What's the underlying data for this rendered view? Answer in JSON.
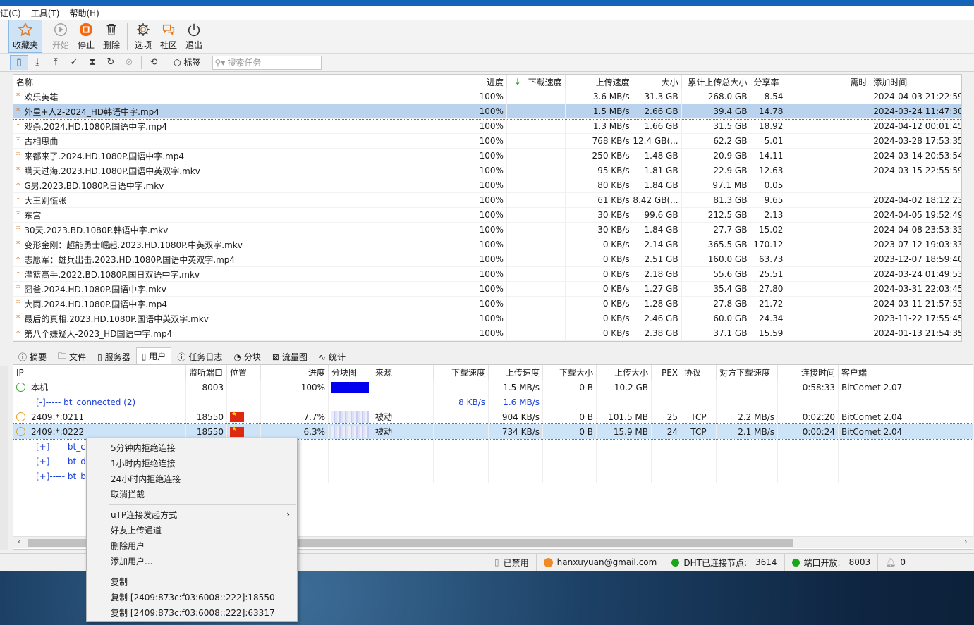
{
  "menu": [
    "证(C)",
    "工具(T)",
    "帮助(H)"
  ],
  "toolbar": {
    "favorites": "收藏夹",
    "start": "开始",
    "stop": "停止",
    "delete": "删除",
    "options": "选项",
    "community": "社区",
    "exit": "退出"
  },
  "filterbar": {
    "tag_label": "标签",
    "search_placeholder": "搜索任务"
  },
  "task_headers": {
    "name": "名称",
    "progress": "进度",
    "down_speed": "下载速度",
    "up_speed": "上传速度",
    "size": "大小",
    "total_up": "累计上传总大小",
    "ratio": "分享率",
    "need": "需时",
    "added": "添加时间"
  },
  "tasks": [
    {
      "name": "欢乐英雄",
      "progress": "100%",
      "up": "3.6 MB/s",
      "size": "31.3 GB",
      "total": "268.0 GB",
      "ratio": "8.54",
      "added": "2024-04-03 21:22:59"
    },
    {
      "name": "外星+人2-2024_HD韩语中字.mp4",
      "progress": "100%",
      "up": "1.5 MB/s",
      "size": "2.66 GB",
      "total": "39.4 GB",
      "ratio": "14.78",
      "added": "2024-03-24 11:47:30"
    },
    {
      "name": "戏杀.2024.HD.1080P.国语中字.mp4",
      "progress": "100%",
      "up": "1.3 MB/s",
      "size": "1.66 GB",
      "total": "31.5 GB",
      "ratio": "18.92",
      "added": "2024-04-12 00:01:45"
    },
    {
      "name": "古相思曲",
      "progress": "100%",
      "up": "768 KB/s",
      "size": "12.4 GB(...",
      "total": "62.2 GB",
      "ratio": "5.01",
      "added": "2024-03-28 17:53:35"
    },
    {
      "name": "来都来了.2024.HD.1080P.国语中字.mp4",
      "progress": "100%",
      "up": "250 KB/s",
      "size": "1.48 GB",
      "total": "20.9 GB",
      "ratio": "14.11",
      "added": "2024-03-14 20:53:54"
    },
    {
      "name": "瞒天过海.2023.HD.1080P.国语中英双字.mkv",
      "progress": "100%",
      "up": "95 KB/s",
      "size": "1.81 GB",
      "total": "22.9 GB",
      "ratio": "12.63",
      "added": "2024-03-15 22:55:59"
    },
    {
      "name": "G男.2023.BD.1080P.日语中字.mkv",
      "progress": "100%",
      "up": "80 KB/s",
      "size": "1.84 GB",
      "total": "97.1 MB",
      "ratio": "0.05",
      "added": ""
    },
    {
      "name": "大王别慌张",
      "progress": "100%",
      "up": "61 KB/s",
      "size": "8.42 GB(...",
      "total": "81.3 GB",
      "ratio": "9.65",
      "added": "2024-04-02 18:12:23"
    },
    {
      "name": "东宫",
      "progress": "100%",
      "up": "30 KB/s",
      "size": "99.6 GB",
      "total": "212.5 GB",
      "ratio": "2.13",
      "added": "2024-04-05 19:52:49"
    },
    {
      "name": "30天.2023.BD.1080P.韩语中字.mkv",
      "progress": "100%",
      "up": "30 KB/s",
      "size": "1.84 GB",
      "total": "27.7 GB",
      "ratio": "15.02",
      "added": "2024-04-08 23:53:33"
    },
    {
      "name": "变形金刚：超能勇士崛起.2023.HD.1080P.中英双字.mkv",
      "progress": "100%",
      "up": "0 KB/s",
      "size": "2.14 GB",
      "total": "365.5 GB",
      "ratio": "170.12",
      "added": "2023-07-12 19:03:33"
    },
    {
      "name": "志愿军：雄兵出击.2023.HD.1080P.国语中英双字.mp4",
      "progress": "100%",
      "up": "0 KB/s",
      "size": "2.51 GB",
      "total": "160.0 GB",
      "ratio": "63.73",
      "added": "2023-12-07 18:59:40"
    },
    {
      "name": "灌篮高手.2022.BD.1080P.国日双语中字.mkv",
      "progress": "100%",
      "up": "0 KB/s",
      "size": "2.18 GB",
      "total": "55.6 GB",
      "ratio": "25.51",
      "added": "2024-03-24 01:49:53"
    },
    {
      "name": "囧爸.2024.HD.1080P.国语中字.mkv",
      "progress": "100%",
      "up": "0 KB/s",
      "size": "1.27 GB",
      "total": "35.4 GB",
      "ratio": "27.80",
      "added": "2024-03-31 22:03:45"
    },
    {
      "name": "大雨.2024.HD.1080P.国语中字.mp4",
      "progress": "100%",
      "up": "0 KB/s",
      "size": "1.28 GB",
      "total": "27.8 GB",
      "ratio": "21.72",
      "added": "2024-03-11 21:57:53"
    },
    {
      "name": "最后的真相.2023.HD.1080P.国语中英双字.mkv",
      "progress": "100%",
      "up": "0 KB/s",
      "size": "2.46 GB",
      "total": "60.0 GB",
      "ratio": "24.34",
      "added": "2023-11-22 17:55:45"
    },
    {
      "name": "第八个嫌疑人-2023_HD国语中字.mp4",
      "progress": "100%",
      "up": "0 KB/s",
      "size": "2.38 GB",
      "total": "37.1 GB",
      "ratio": "15.59",
      "added": "2024-01-13 21:54:35"
    }
  ],
  "tabs": [
    "摘要",
    "文件",
    "服务器",
    "用户",
    "任务日志",
    "分块",
    "流量图",
    "统计"
  ],
  "peer_headers": {
    "ip": "IP",
    "port": "监听端口",
    "loc": "位置",
    "prog": "进度",
    "map": "分块图",
    "src": "来源",
    "dn": "下载速度",
    "up": "上传速度",
    "dsz": "下载大小",
    "usz": "上传大小",
    "pex": "PEX",
    "proto": "协议",
    "peer": "对方下载速度",
    "time": "连接时间",
    "cli": "客户端"
  },
  "peers": [
    {
      "ip": "本机",
      "port": "8003",
      "prog": "100%",
      "src": "",
      "dn": "",
      "up": "1.5 MB/s",
      "dsz": "0 B",
      "usz": "10.2 GB",
      "pex": "",
      "proto": "",
      "peer": "",
      "time": "0:58:33",
      "cli": "BitComet 2.07"
    },
    {
      "ip": "[-]----- bt_connected (2)",
      "port": "",
      "prog": "",
      "src": "",
      "dn": "8 KB/s",
      "up": "1.6 MB/s",
      "dsz": "",
      "usz": "",
      "pex": "",
      "proto": "",
      "peer": "",
      "time": "",
      "cli": ""
    },
    {
      "ip": "2409:*:0211",
      "port": "18550",
      "prog": "7.7%",
      "src": "被动",
      "dn": "",
      "up": "904 KB/s",
      "dsz": "0 B",
      "usz": "101.5 MB",
      "pex": "25",
      "proto": "TCP",
      "peer": "2.2 MB/s",
      "time": "0:02:20",
      "cli": "BitComet 2.04"
    },
    {
      "ip": "2409:*:0222",
      "port": "18550",
      "prog": "6.3%",
      "src": "被动",
      "dn": "",
      "up": "734 KB/s",
      "dsz": "0 B",
      "usz": "15.9 MB",
      "pex": "24",
      "proto": "TCP",
      "peer": "2.1 MB/s",
      "time": "0:00:24",
      "cli": "BitComet 2.04"
    },
    {
      "ip": "[+]----- bt_c",
      "port": "",
      "prog": "",
      "src": "",
      "dn": "",
      "up": "",
      "dsz": "",
      "usz": "",
      "pex": "",
      "proto": "",
      "peer": "",
      "time": "",
      "cli": ""
    },
    {
      "ip": "[+]----- bt_d",
      "port": "",
      "prog": "",
      "src": "",
      "dn": "",
      "up": "",
      "dsz": "",
      "usz": "",
      "pex": "",
      "proto": "",
      "peer": "",
      "time": "",
      "cli": ""
    },
    {
      "ip": "[+]----- bt_b",
      "port": "",
      "prog": "",
      "src": "",
      "dn": "",
      "up": "",
      "dsz": "",
      "usz": "",
      "pex": "",
      "proto": "",
      "peer": "",
      "time": "",
      "cli": ""
    }
  ],
  "statusbar": {
    "disabled": "已禁用",
    "email": "hanxuyuan@gmail.com",
    "dht_label": "DHT已连接节点:",
    "dht_count": "3614",
    "port_label": "端口开放:",
    "port": "8003",
    "notif": "0"
  },
  "context_menu": {
    "items_a": [
      "5分钟内拒绝连接",
      "1小时内拒绝连接",
      "24小时内拒绝连接",
      "取消拦截"
    ],
    "items_b": [
      "uTP连接发起方式",
      "好友上传通道",
      "删除用户",
      "添加用户..."
    ],
    "items_c": [
      "复制",
      "复制 [2409:873c:f03:6008::222]:18550",
      "复制 [2409:873c:f03:6008::222]:63317"
    ]
  }
}
